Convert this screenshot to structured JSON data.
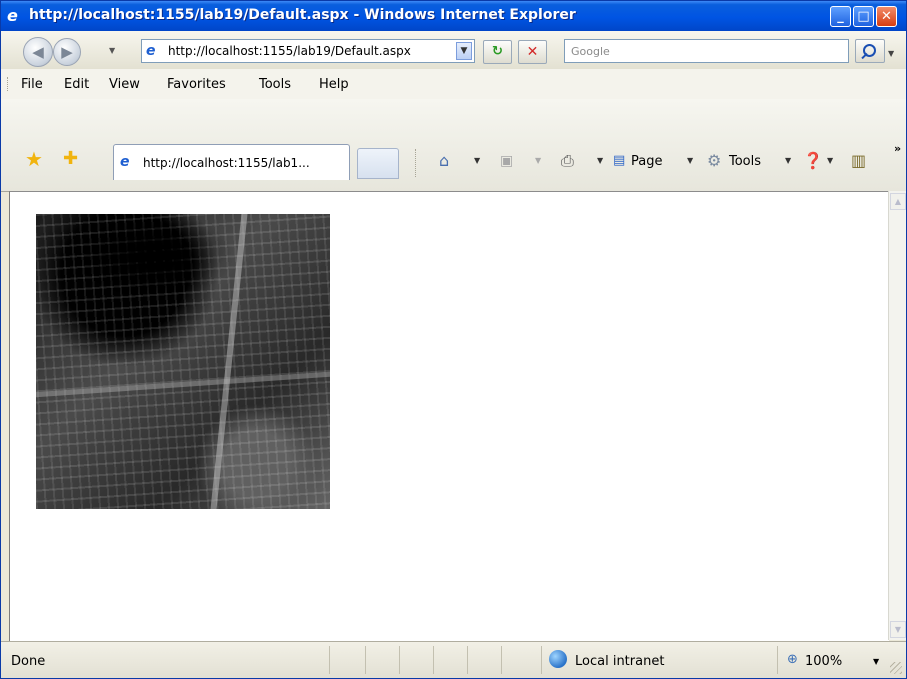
{
  "window": {
    "title": "http://localhost:1155/lab19/Default.aspx - Windows Internet Explorer",
    "minimize_glyph": "_",
    "maximize_glyph": "□",
    "close_glyph": "✕"
  },
  "address_bar": {
    "url": "http://localhost:1155/lab19/Default.aspx"
  },
  "search": {
    "placeholder": "Google"
  },
  "menu": {
    "items": [
      {
        "label": "File"
      },
      {
        "label": "Edit"
      },
      {
        "label": "View"
      },
      {
        "label": "Favorites"
      },
      {
        "label": "Tools"
      },
      {
        "label": "Help"
      }
    ]
  },
  "tabs": [
    {
      "label": "http://localhost:1155/lab1..."
    }
  ],
  "command_bar": {
    "page_label": "Page",
    "tools_label": "Tools",
    "overflow_glyph": "»"
  },
  "content": {
    "image_description_icon": "aerial-city-photo"
  },
  "status": {
    "text": "Done",
    "zone": "Local intranet",
    "zoom": "100%"
  }
}
